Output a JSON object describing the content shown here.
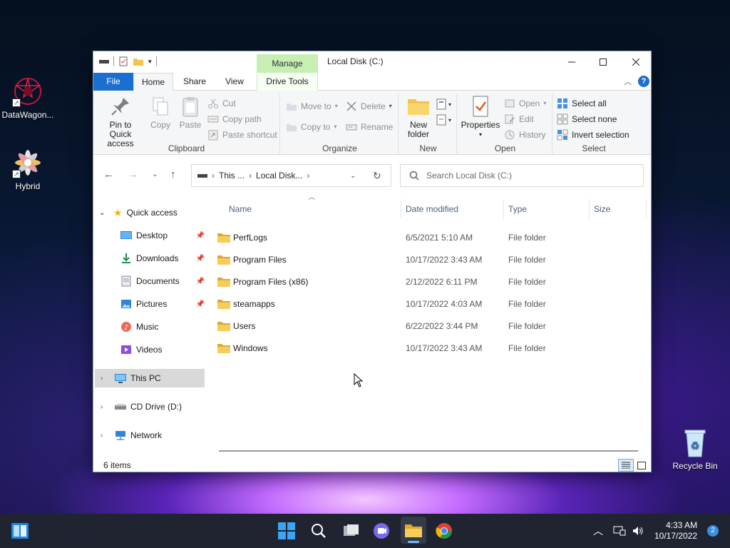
{
  "desktop": {
    "icons": [
      {
        "label": "DataWagon..."
      },
      {
        "label": "Hybrid"
      },
      {
        "label": "Recycle Bin"
      }
    ]
  },
  "window": {
    "context_tab": "Manage",
    "title": "Local Disk (C:)",
    "tabs": {
      "file": "File",
      "home": "Home",
      "share": "Share",
      "view": "View",
      "drive_tools": "Drive Tools"
    },
    "ribbon": {
      "clipboard": {
        "label": "Clipboard",
        "pin": "Pin to Quick\naccess",
        "copy": "Copy",
        "paste": "Paste",
        "cut": "Cut",
        "copy_path": "Copy path",
        "paste_shortcut": "Paste shortcut"
      },
      "organize": {
        "label": "Organize",
        "move_to": "Move to",
        "copy_to": "Copy to",
        "delete": "Delete",
        "rename": "Rename"
      },
      "new": {
        "label": "New",
        "new_folder": "New\nfolder"
      },
      "open": {
        "label": "Open",
        "properties": "Properties",
        "open": "Open",
        "edit": "Edit",
        "history": "History"
      },
      "select": {
        "label": "Select",
        "select_all": "Select all",
        "select_none": "Select none",
        "invert": "Invert selection"
      }
    },
    "address": {
      "crumb1": "This ...",
      "crumb2": "Local Disk...",
      "search_placeholder": "Search Local Disk (C:)"
    },
    "nav": {
      "quick_access": "Quick access",
      "desktop": "Desktop",
      "downloads": "Downloads",
      "documents": "Documents",
      "pictures": "Pictures",
      "music": "Music",
      "videos": "Videos",
      "this_pc": "This PC",
      "cd_drive": "CD Drive (D:)",
      "network": "Network"
    },
    "columns": {
      "name": "Name",
      "date": "Date modified",
      "type": "Type",
      "size": "Size"
    },
    "files": [
      {
        "name": "PerfLogs",
        "date": "6/5/2021 5:10 AM",
        "type": "File folder"
      },
      {
        "name": "Program Files",
        "date": "10/17/2022 3:43 AM",
        "type": "File folder"
      },
      {
        "name": "Program Files (x86)",
        "date": "2/12/2022 6:11 PM",
        "type": "File folder"
      },
      {
        "name": "steamapps",
        "date": "10/17/2022 4:03 AM",
        "type": "File folder"
      },
      {
        "name": "Users",
        "date": "6/22/2022 3:44 PM",
        "type": "File folder"
      },
      {
        "name": "Windows",
        "date": "10/17/2022 3:43 AM",
        "type": "File folder"
      }
    ],
    "status": "6 items"
  },
  "taskbar": {
    "time": "4:33 AM",
    "date": "10/17/2022",
    "notifications": "2"
  },
  "colors": {
    "accent": "#1a6fcf",
    "manage_tab": "#c7efb4",
    "folder": "#f2c44d"
  }
}
